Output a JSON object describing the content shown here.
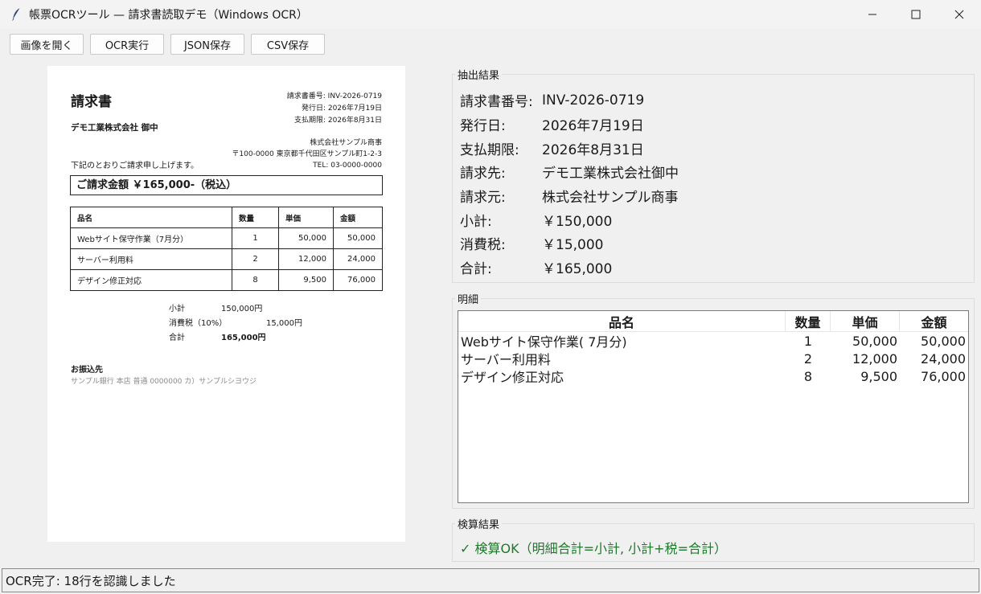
{
  "window": {
    "title": "帳票OCRツール — 請求書読取デモ（Windows OCR）",
    "icon": "feather-icon"
  },
  "toolbar": {
    "open_image": "画像を開く",
    "run_ocr": "OCR実行",
    "save_json": "JSON保存",
    "save_csv": "CSV保存"
  },
  "document": {
    "title": "請求書",
    "invoice_no": "請求書番号: INV-2026-0719",
    "issue_date": "発行日: 2026年7月19日",
    "due_date": "支払期限: 2026年8月31日",
    "customer": "デモ工業株式会社 御中",
    "issuer_name": "株式会社サンプル商事",
    "issuer_address": "〒100-0000 東京都千代田区サンプル町1-2-3",
    "issuer_tel": "TEL: 03-0000-0000",
    "greeting": "下記のとおりご請求申し上げます。",
    "total_banner": "ご請求金額 ￥165,000-（税込）",
    "headers": [
      "品名",
      "数量",
      "単価",
      "金額"
    ],
    "rows": [
      [
        "Webサイト保守作業（7月分）",
        "1",
        "50,000",
        "50,000"
      ],
      [
        "サーバー利用料",
        "2",
        "12,000",
        "24,000"
      ],
      [
        "デザイン修正対応",
        "8",
        "9,500",
        "76,000"
      ]
    ],
    "subtotal_label": "小計",
    "subtotal_value": "150,000円",
    "tax_label": "消費税（10%）",
    "tax_value": "15,000円",
    "total_label": "合計",
    "total_value": "165,000円",
    "bank_title": "お振込先",
    "bank_info": "サンプル銀行 本店 普通 0000000 カ）サンプルシヨウジ"
  },
  "extract": {
    "label": "抽出結果",
    "fields": [
      {
        "key": "請求書番号:",
        "value": "INV-2026-0719"
      },
      {
        "key": "発行日:",
        "value": "2026年7月19日"
      },
      {
        "key": "支払期限:",
        "value": "2026年8月31日"
      },
      {
        "key": "請求先:",
        "value": "デモ工業株式会社御中"
      },
      {
        "key": "請求元:",
        "value": "株式会社サンプル商事"
      },
      {
        "key": "小計:",
        "value": "￥150,000"
      },
      {
        "key": "消費税:",
        "value": "￥15,000"
      },
      {
        "key": "合計:",
        "value": "￥165,000"
      }
    ]
  },
  "detail": {
    "label": "明細",
    "headers": [
      "品名",
      "数量",
      "単価",
      "金額"
    ],
    "rows": [
      [
        "Webサイト保守作業( 7月分)",
        "1",
        "50,000",
        "50,000"
      ],
      [
        "サーバー利用料",
        "2",
        "12,000",
        "24,000"
      ],
      [
        "デザイン修正対応",
        "8",
        "9,500",
        "76,000"
      ]
    ]
  },
  "check": {
    "label": "検算結果",
    "result": "✓ 検算OK（明細合計=小計, 小計+税=合計）",
    "color": "#1e7a2b"
  },
  "status": "OCR完了: 18行を認識しました"
}
